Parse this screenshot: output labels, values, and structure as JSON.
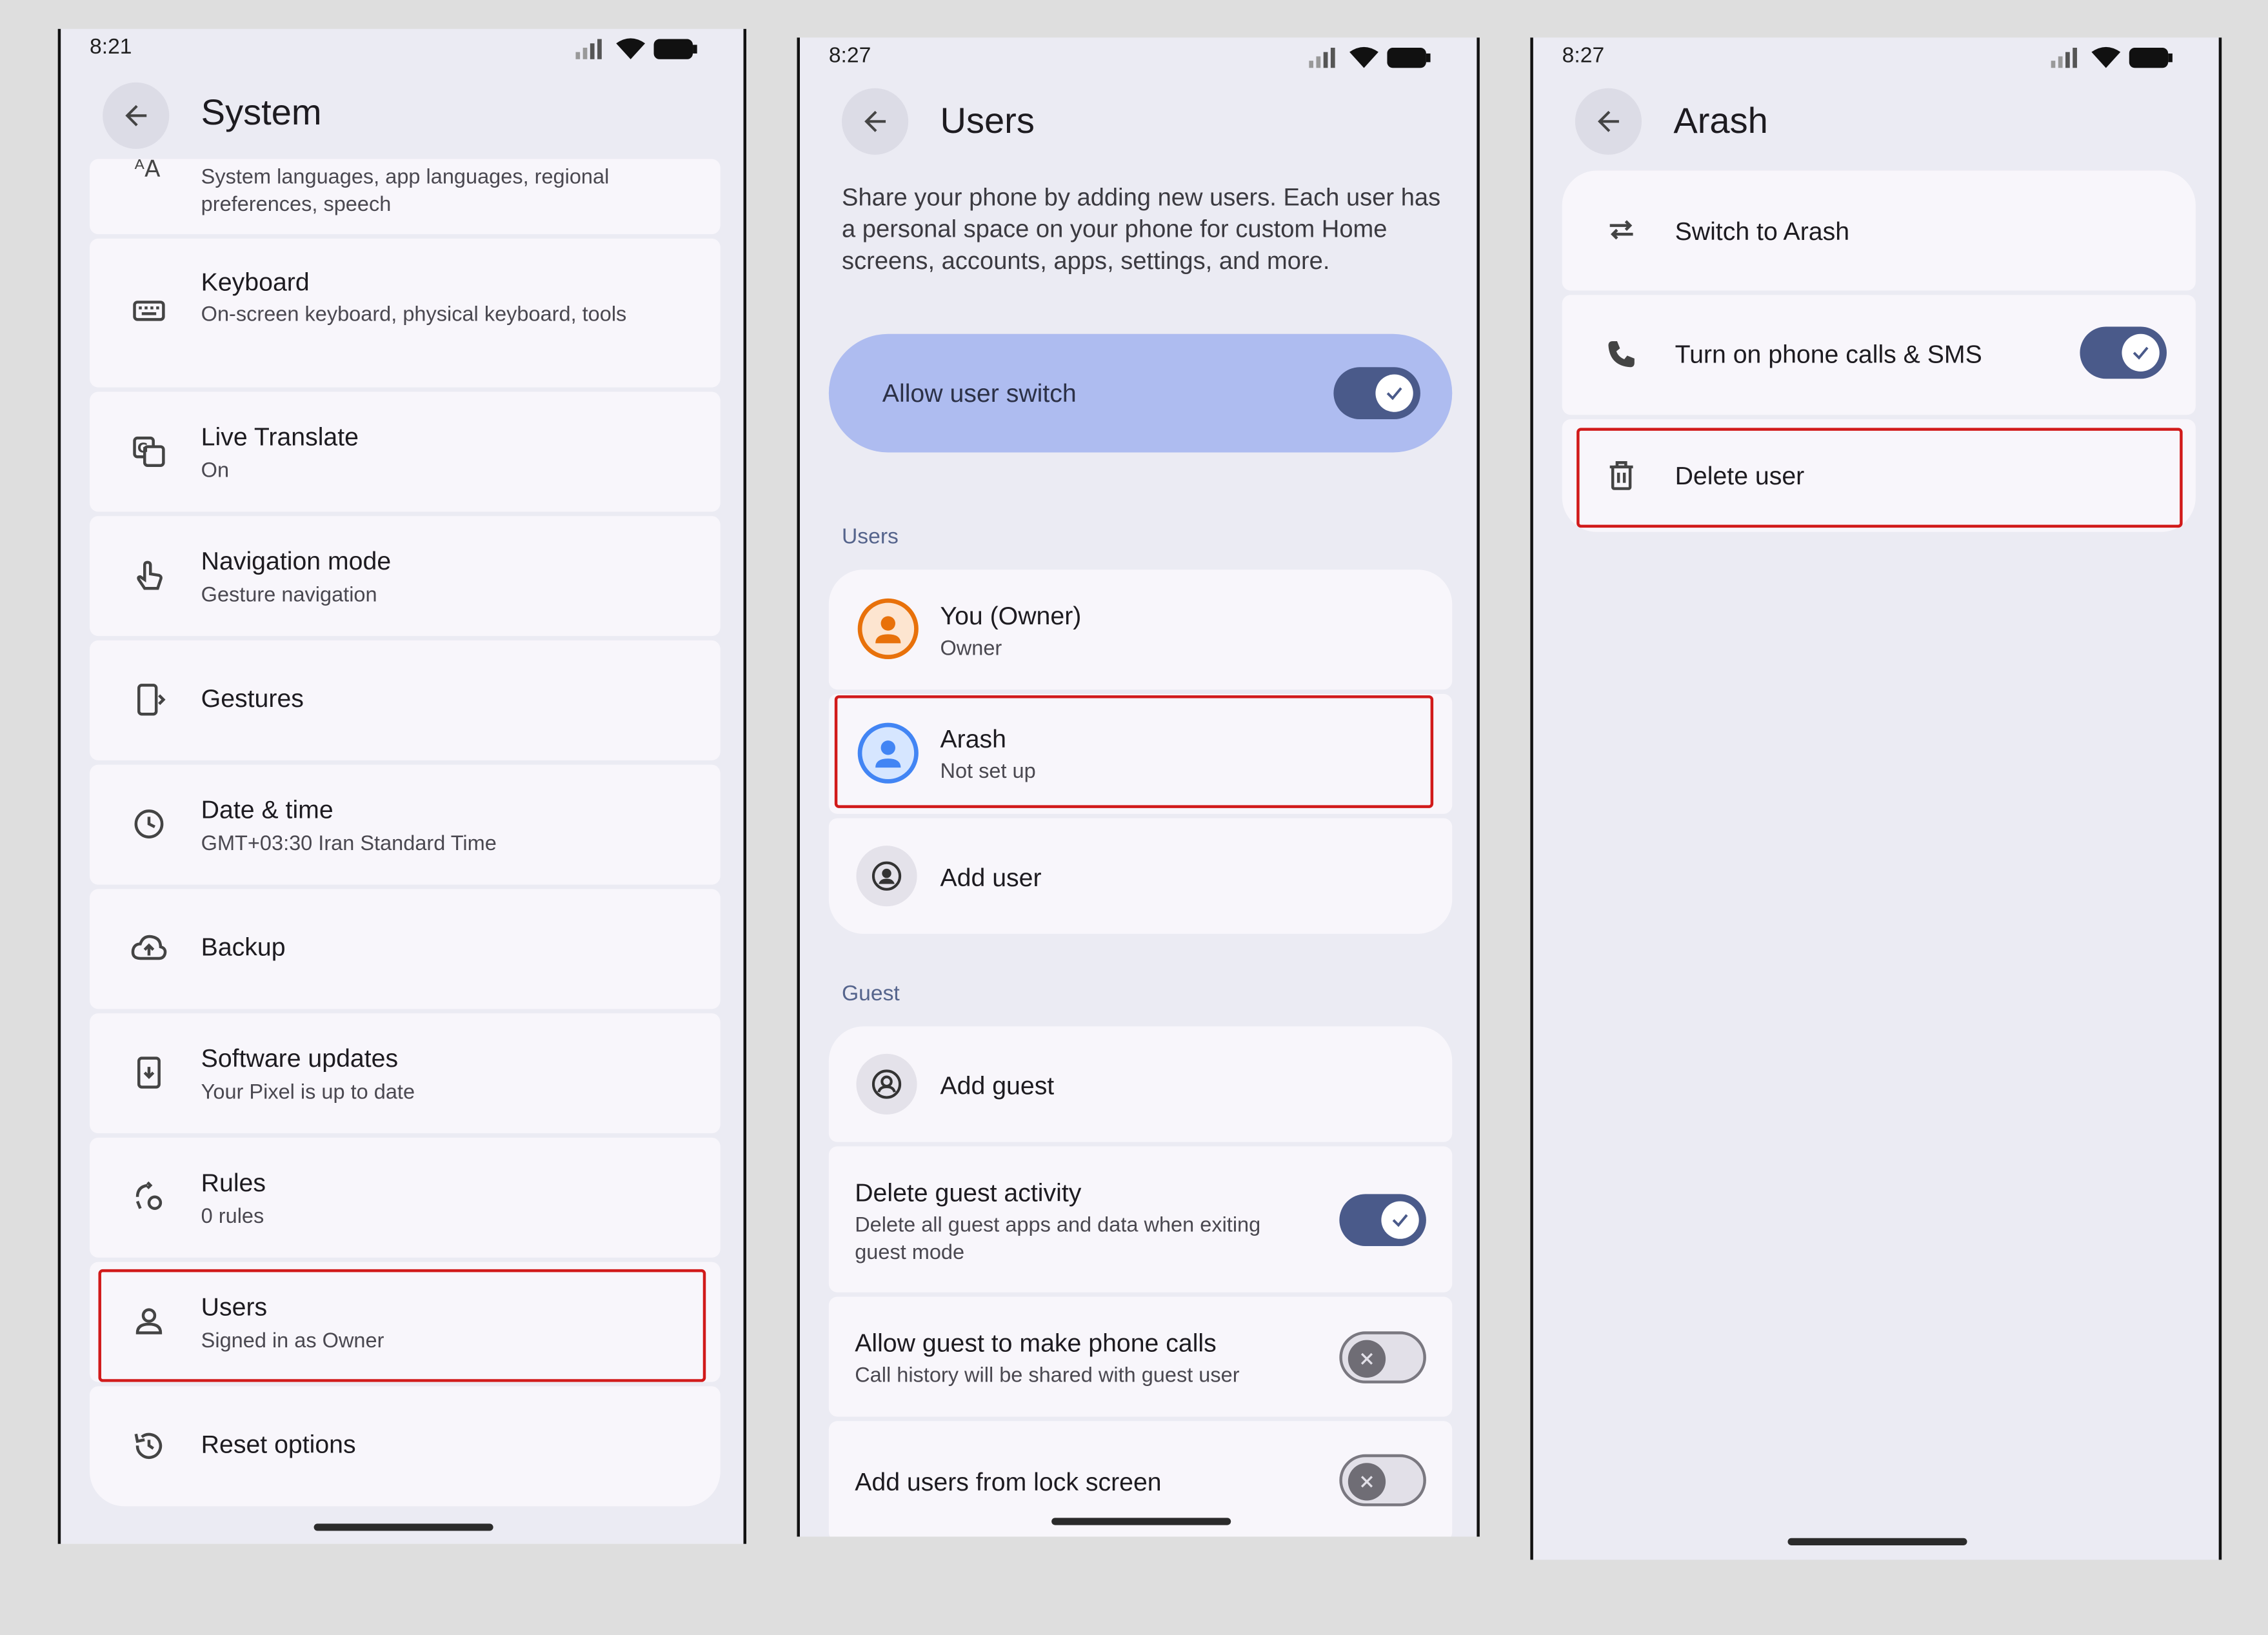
{
  "screen1": {
    "time": "8:21",
    "title": "System",
    "items": [
      {
        "title": "",
        "subtitle": "System languages, app languages, regional preferences, speech",
        "icon": "language-icon"
      },
      {
        "title": "Keyboard",
        "subtitle": "On-screen keyboard, physical keyboard, tools",
        "icon": "keyboard-icon"
      },
      {
        "title": "Live Translate",
        "subtitle": "On",
        "icon": "translate-icon"
      },
      {
        "title": "Navigation mode",
        "subtitle": "Gesture navigation",
        "icon": "gesture-hand-icon"
      },
      {
        "title": "Gestures",
        "subtitle": "",
        "icon": "phone-gesture-icon"
      },
      {
        "title": "Date & time",
        "subtitle": "GMT+03:30 Iran Standard Time",
        "icon": "clock-icon"
      },
      {
        "title": "Backup",
        "subtitle": "",
        "icon": "cloud-upload-icon"
      },
      {
        "title": "Software updates",
        "subtitle": "Your Pixel is up to date",
        "icon": "system-update-icon"
      },
      {
        "title": "Rules",
        "subtitle": "0 rules",
        "icon": "rules-icon"
      },
      {
        "title": "Users",
        "subtitle": "Signed in as Owner",
        "icon": "person-icon"
      },
      {
        "title": "Reset options",
        "subtitle": "",
        "icon": "history-icon"
      }
    ]
  },
  "screen2": {
    "time": "8:27",
    "title": "Users",
    "description": "Share your phone by adding new users. Each user has a personal space on your phone for custom Home screens, accounts, apps, settings, and more.",
    "allow_switch_label": "Allow user switch",
    "users_section": "Users",
    "owner_title": "You (Owner)",
    "owner_sub": "Owner",
    "arash_title": "Arash",
    "arash_sub": "Not set up",
    "add_user": "Add user",
    "guest_section": "Guest",
    "add_guest": "Add guest",
    "delete_guest_title": "Delete guest activity",
    "delete_guest_sub": "Delete all guest apps and data when exiting guest mode",
    "guest_calls_title": "Allow guest to make phone calls",
    "guest_calls_sub": "Call history will be shared with guest user",
    "lock_screen_title": "Add users from lock screen",
    "colors": {
      "owner_avatar": "#e8710a",
      "arash_avatar": "#4285f4",
      "accent_toggle": "#4a5a8a",
      "allow_bg": "#aebcf0"
    }
  },
  "screen3": {
    "time": "8:27",
    "title": "Arash",
    "switch_to": "Switch to Arash",
    "phone_calls": "Turn on phone calls & SMS",
    "delete_user": "Delete user"
  }
}
